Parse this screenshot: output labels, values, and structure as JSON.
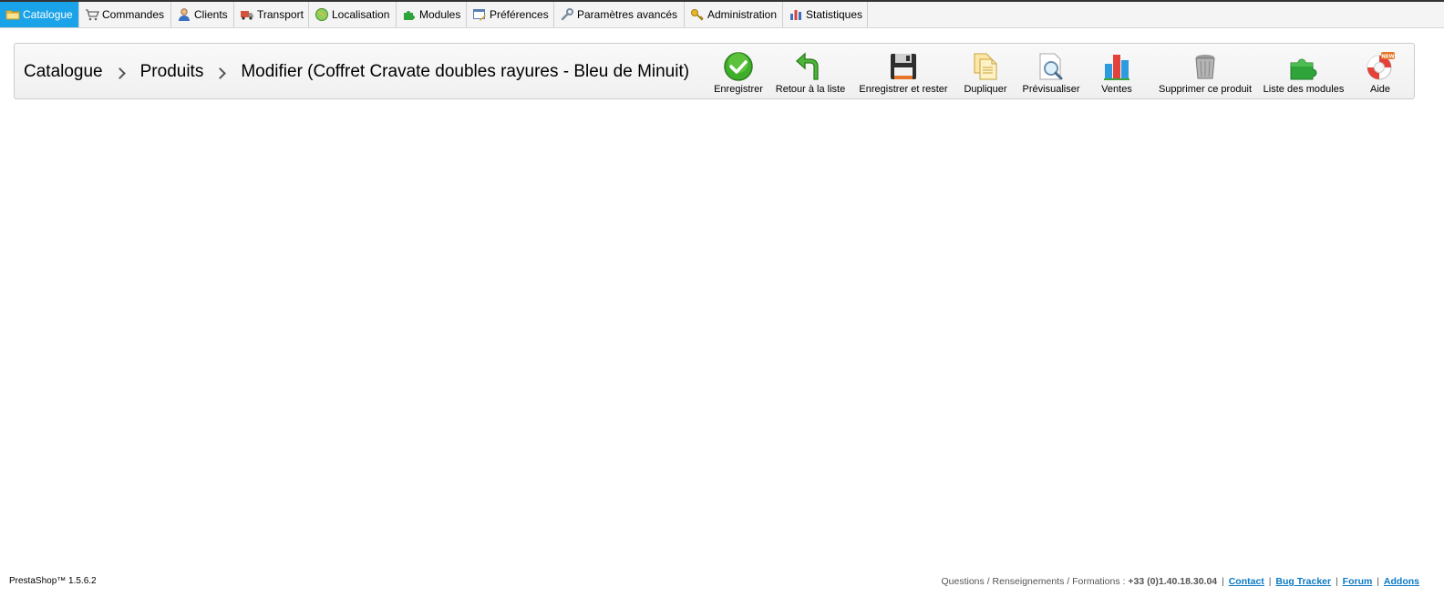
{
  "menu": {
    "items": [
      {
        "label": "Catalogue",
        "icon": "folder-icon",
        "active": true
      },
      {
        "label": "Commandes",
        "icon": "cart-icon",
        "active": false
      },
      {
        "label": "Clients",
        "icon": "user-icon",
        "active": false
      },
      {
        "label": "Transport",
        "icon": "truck-icon",
        "active": false
      },
      {
        "label": "Localisation",
        "icon": "globe-icon",
        "active": false
      },
      {
        "label": "Modules",
        "icon": "puzzle-icon",
        "active": false
      },
      {
        "label": "Préférences",
        "icon": "preferences-icon",
        "active": false
      },
      {
        "label": "Paramètres avancés",
        "icon": "wrench-icon",
        "active": false
      },
      {
        "label": "Administration",
        "icon": "key-icon",
        "active": false
      },
      {
        "label": "Statistiques",
        "icon": "bar-chart-icon",
        "active": false
      }
    ]
  },
  "breadcrumb": {
    "level1": "Catalogue",
    "level2": "Produits",
    "level3": "Modifier (Coffret Cravate doubles rayures - Bleu de Minuit)"
  },
  "toolbar": {
    "save": "Enregistrer",
    "back": "Retour à la liste",
    "save_stay": "Enregistrer et rester",
    "duplicate": "Dupliquer",
    "preview": "Prévisualiser",
    "sales": "Ventes",
    "delete": "Supprimer ce produit",
    "modules": "Liste des modules",
    "help": "Aide",
    "help_badge": "NEW"
  },
  "footer": {
    "version": "PrestaShop™ 1.5.6.2",
    "questions": "Questions / Renseignements / Formations : ",
    "phone": "+33 (0)1.40.18.30.04",
    "separator": "|",
    "links": {
      "contact": "Contact",
      "bug_tracker": "Bug Tracker",
      "forum": "Forum",
      "addons": "Addons"
    }
  },
  "colors": {
    "active_tab": "#1aa3e8",
    "link": "#0a79c4"
  }
}
